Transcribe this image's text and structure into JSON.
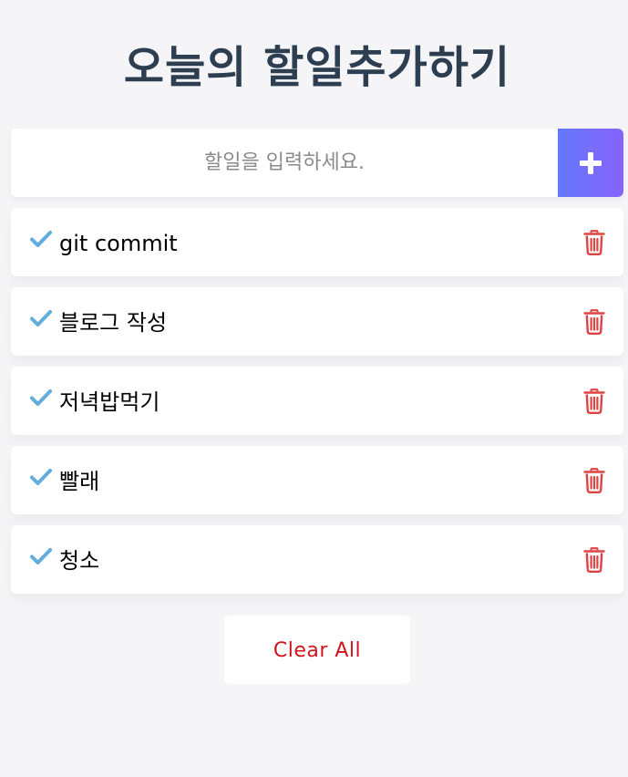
{
  "header": {
    "title": "오늘의 할일추가하기"
  },
  "input": {
    "placeholder": "할일을 입력하세요.",
    "value": "",
    "add_icon": "plus-icon"
  },
  "todos": [
    {
      "text": "git commit",
      "done_icon": "check-icon",
      "delete_icon": "trash-icon"
    },
    {
      "text": "블로그 작성",
      "done_icon": "check-icon",
      "delete_icon": "trash-icon"
    },
    {
      "text": "저녁밥먹기",
      "done_icon": "check-icon",
      "delete_icon": "trash-icon"
    },
    {
      "text": "빨래",
      "done_icon": "check-icon",
      "delete_icon": "trash-icon"
    },
    {
      "text": "청소",
      "done_icon": "check-icon",
      "delete_icon": "trash-icon"
    }
  ],
  "footer": {
    "clear_label": "Clear All"
  },
  "colors": {
    "title": "#2c3e50",
    "add_gradient_start": "#6478fb",
    "add_gradient_end": "#8763fb",
    "check": "#62acde",
    "trash": "#de4343",
    "clear_text": "#d0141c"
  }
}
